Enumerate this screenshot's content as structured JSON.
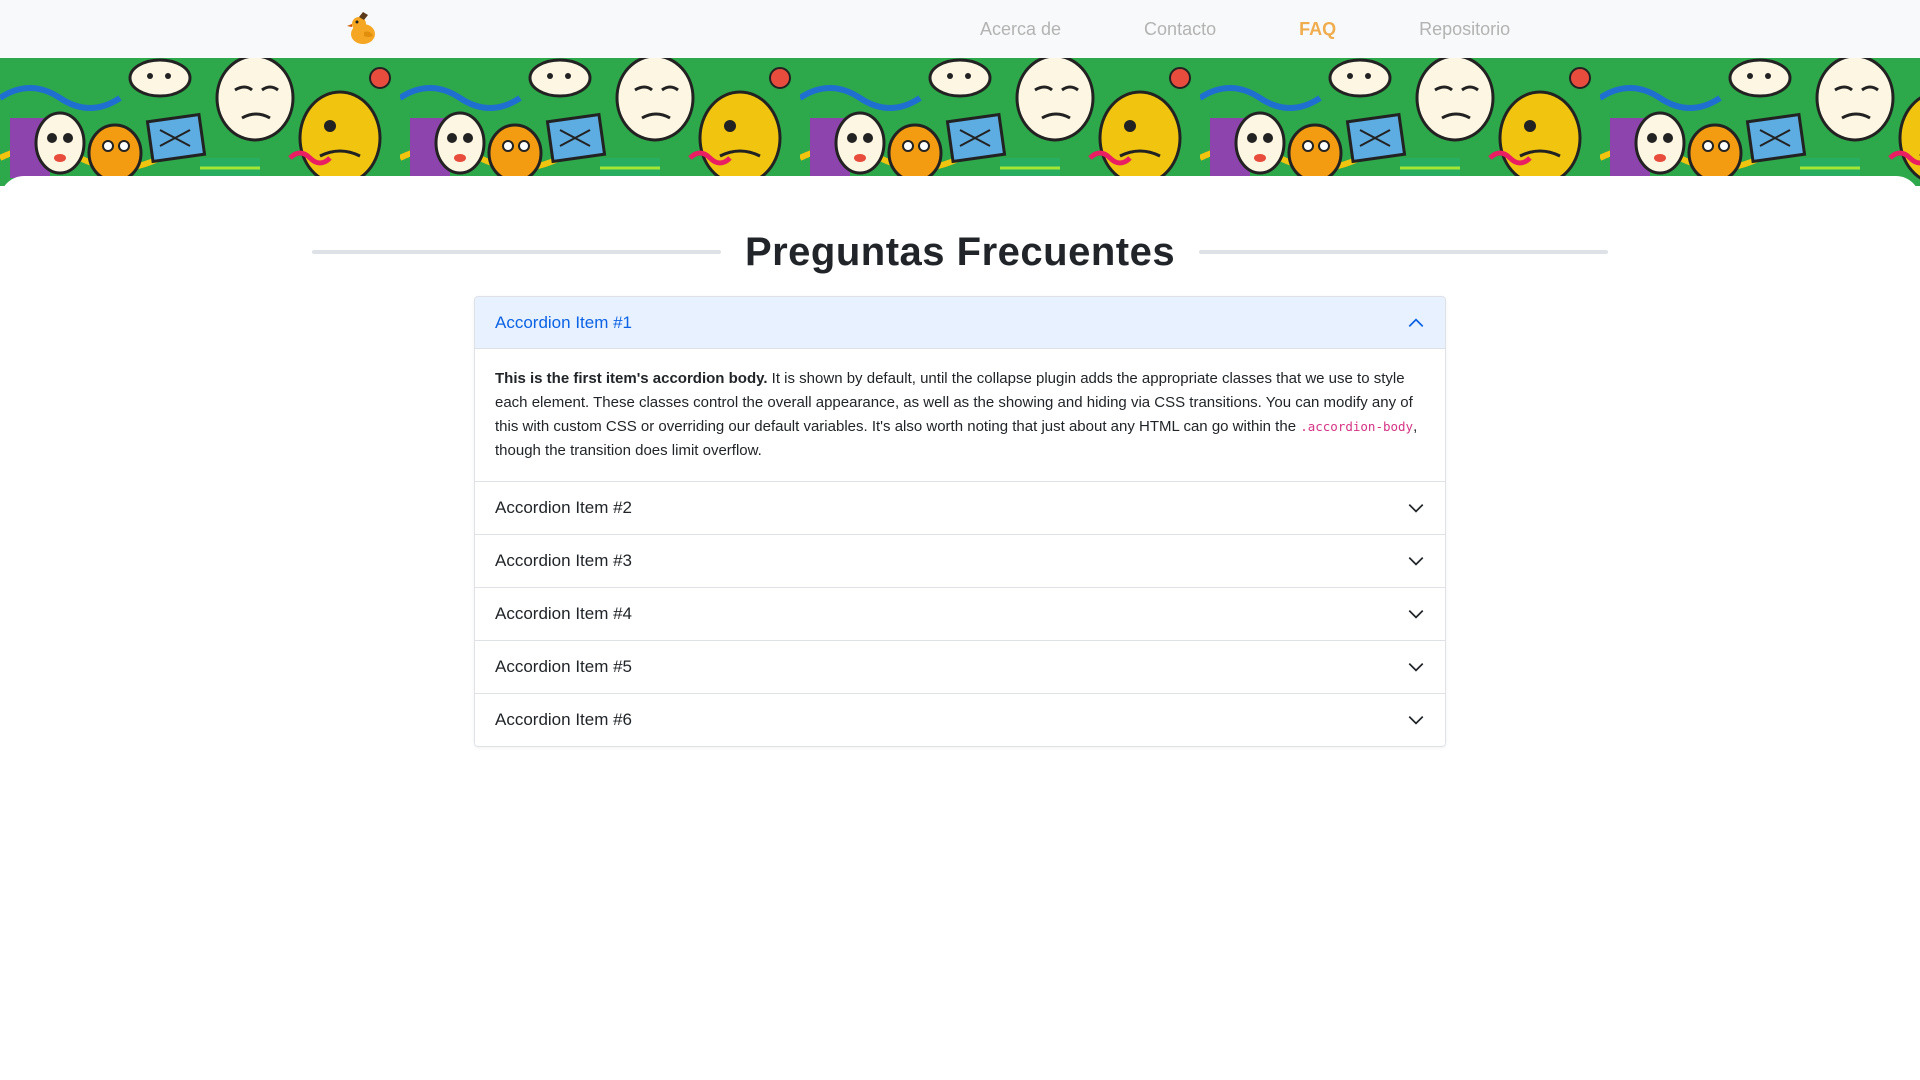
{
  "nav": {
    "items": [
      {
        "label": "Acerca de",
        "active": false
      },
      {
        "label": "Contacto",
        "active": false
      },
      {
        "label": "FAQ",
        "active": true
      },
      {
        "label": "Repositorio",
        "active": false
      }
    ]
  },
  "page": {
    "title": "Preguntas Frecuentes"
  },
  "accordion": {
    "items": [
      {
        "label": "Accordion Item #1",
        "open": true
      },
      {
        "label": "Accordion Item #2",
        "open": false
      },
      {
        "label": "Accordion Item #3",
        "open": false
      },
      {
        "label": "Accordion Item #4",
        "open": false
      },
      {
        "label": "Accordion Item #5",
        "open": false
      },
      {
        "label": "Accordion Item #6",
        "open": false
      }
    ],
    "body": {
      "strong": "This is the first item's accordion body.",
      "text1": " It is shown by default, until the collapse plugin adds the appropriate classes that we use to style each element. These classes control the overall appearance, as well as the showing and hiding via CSS transitions. You can modify any of this with custom CSS or overriding our default variables. It's also worth noting that just about any HTML can go within the ",
      "code": ".accordion-body",
      "text2": ", though the transition does limit overflow."
    }
  },
  "colors": {
    "active_nav": "#f0ad4e",
    "open_header_bg": "#e7f1ff",
    "open_header_text": "#0c63e4",
    "code": "#d63384"
  },
  "icons": {
    "logo": "duck-logo-icon",
    "open": "chevron-up-icon",
    "closed": "chevron-down-icon"
  }
}
